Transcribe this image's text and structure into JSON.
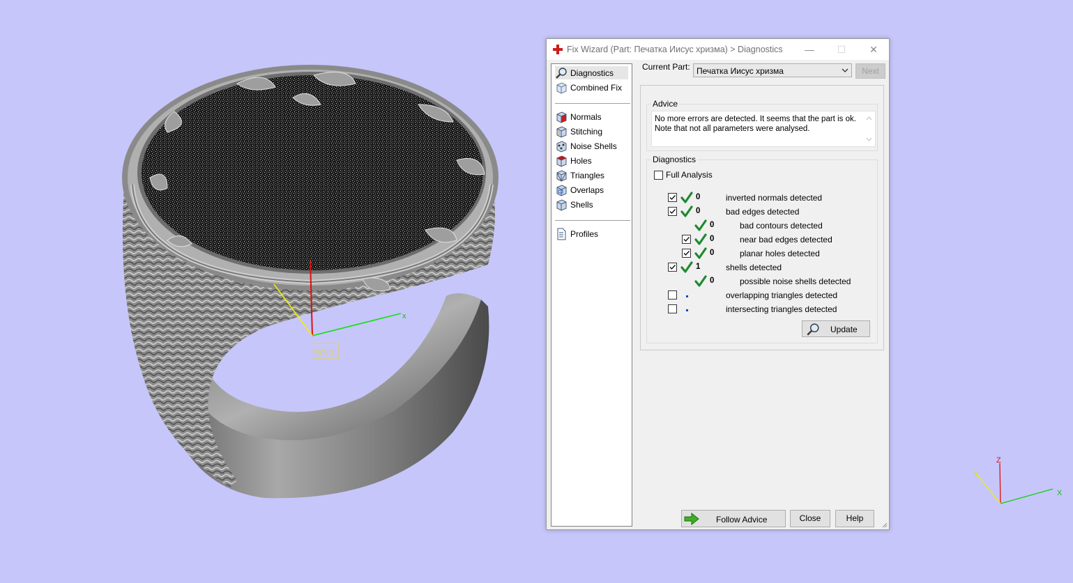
{
  "viewport": {
    "wcs_label": "WCS",
    "axis_x_label": "x",
    "corner_axes": {
      "z": "Z",
      "x": "X",
      "y": "Y"
    },
    "background_color": "#c6c6fa"
  },
  "dialog": {
    "title": "Fix Wizard (Part: Печатка Иисус хризма) > Diagnostics",
    "window_buttons": {
      "minimize": "—",
      "maximize": "☐",
      "close": "✕"
    },
    "nav": {
      "top_items": [
        {
          "label": "Diagnostics",
          "icon": "magnifier-icon",
          "selected": true
        },
        {
          "label": "Combined Fix",
          "icon": "cube-icon"
        }
      ],
      "tool_items": [
        {
          "label": "Normals",
          "icon": "normals-cube-icon"
        },
        {
          "label": "Stitching",
          "icon": "stitching-cube-icon"
        },
        {
          "label": "Noise Shells",
          "icon": "noise-shells-icon"
        },
        {
          "label": "Holes",
          "icon": "holes-cube-icon"
        },
        {
          "label": "Triangles",
          "icon": "triangles-cube-icon"
        },
        {
          "label": "Overlaps",
          "icon": "overlaps-cube-icon"
        },
        {
          "label": "Shells",
          "icon": "shells-cube-icon"
        }
      ],
      "bottom_items": [
        {
          "label": "Profiles",
          "icon": "document-icon"
        }
      ]
    },
    "current_part_label": "Current Part:",
    "current_part_value": "Печатка Иисус хризма",
    "next_button": "Next",
    "advice": {
      "title": "Advice",
      "line1": "No more errors are detected. It seems that the part is ok.",
      "line2": "Note that not all parameters were analysed."
    },
    "diagnostics": {
      "title": "Diagnostics",
      "full_analysis_label": "Full Analysis",
      "full_analysis_checked": false,
      "rows": [
        {
          "checkbox": true,
          "checked": true,
          "status": "ok",
          "count": "0",
          "label": "inverted normals detected",
          "level": 0
        },
        {
          "checkbox": true,
          "checked": true,
          "status": "ok",
          "count": "0",
          "label": "bad edges detected",
          "level": 0
        },
        {
          "checkbox": false,
          "checked": false,
          "status": "ok",
          "count": "0",
          "label": "bad contours detected",
          "level": 1
        },
        {
          "checkbox": true,
          "checked": true,
          "status": "ok",
          "count": "0",
          "label": "near bad edges detected",
          "level": 1
        },
        {
          "checkbox": true,
          "checked": true,
          "status": "ok",
          "count": "0",
          "label": "planar holes detected",
          "level": 1
        },
        {
          "checkbox": true,
          "checked": true,
          "status": "ok",
          "count": "1",
          "label": "shells detected",
          "level": 0
        },
        {
          "checkbox": false,
          "checked": false,
          "status": "ok",
          "count": "0",
          "label": "possible noise shells detected",
          "level": 1
        },
        {
          "checkbox": true,
          "checked": false,
          "status": "none",
          "count": "",
          "label": "overlapping triangles detected",
          "level": 0
        },
        {
          "checkbox": true,
          "checked": false,
          "status": "none",
          "count": "",
          "label": "intersecting triangles detected",
          "level": 0
        }
      ],
      "update_button": "Update"
    },
    "follow_advice_button": "Follow Advice",
    "close_button": "Close",
    "help_button": "Help"
  }
}
